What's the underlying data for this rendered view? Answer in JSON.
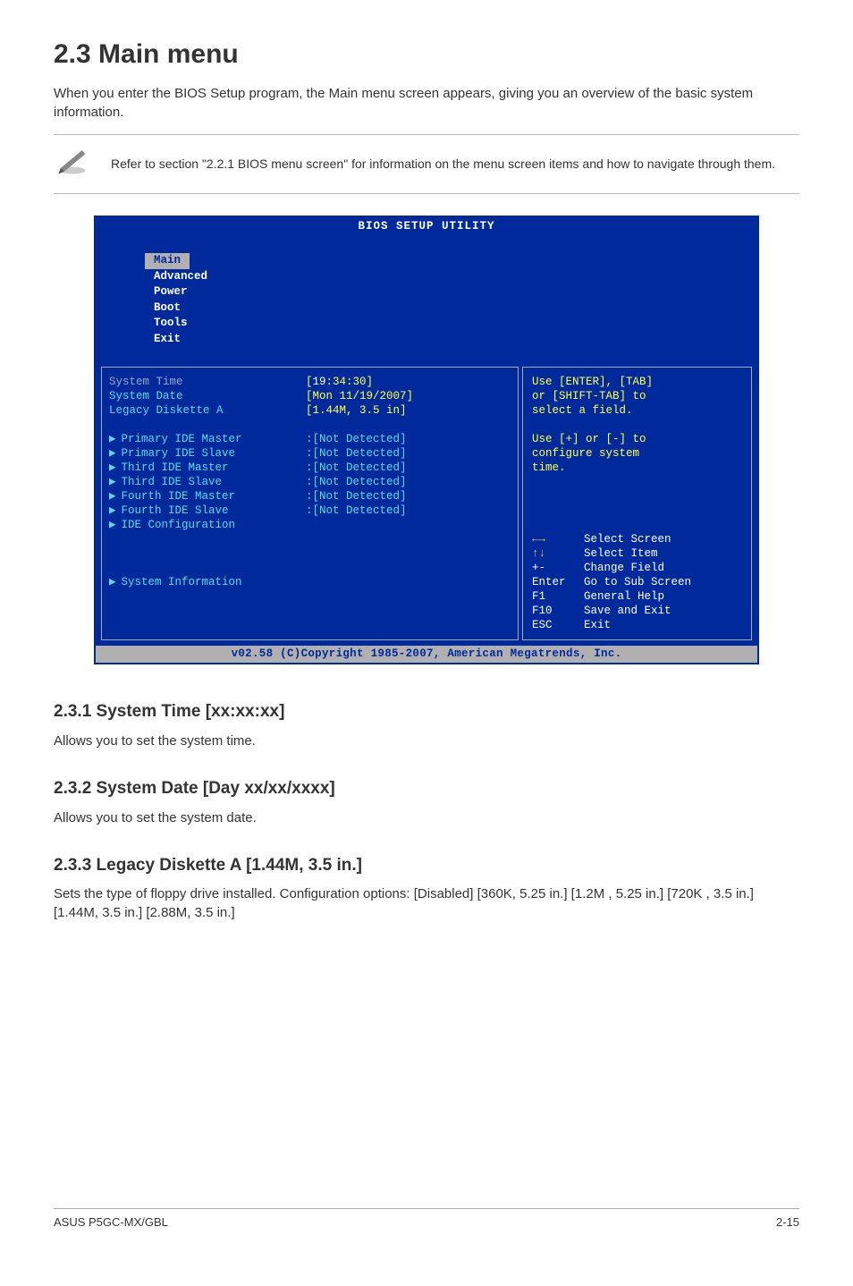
{
  "doc": {
    "section_title": "2.3    Main menu",
    "intro_p": "When you enter the BIOS Setup program, the Main menu screen appears, giving you an overview of the basic system information.",
    "note_text": "Refer to section \"2.2.1  BIOS menu screen\" for information on the menu screen items and how to navigate through them.",
    "sub1_h": "2.3.1     System Time [xx:xx:xx]",
    "sub1_p": "Allows you to set the system time.",
    "sub2_h": "2.3.2     System Date [Day xx/xx/xxxx]",
    "sub2_p": "Allows you to set the system date.",
    "sub3_h": "2.3.3     Legacy Diskette A [1.44M, 3.5 in.]",
    "sub3_p": "Sets the type of floppy drive installed. Configuration options: [Disabled] [360K, 5.25 in.] [1.2M , 5.25 in.] [720K , 3.5 in.] [1.44M, 3.5 in.] [2.88M, 3.5 in.]",
    "footer_left": "ASUS P5GC-MX/GBL",
    "footer_right": "2-15"
  },
  "bios": {
    "title": "BIOS SETUP UTILITY",
    "tabs": {
      "main": "Main",
      "advanced": "Advanced",
      "power": "Power",
      "boot": "Boot",
      "tools": "Tools",
      "exit": "Exit"
    },
    "left": {
      "sys_time_label": "System Time",
      "sys_time_value_prefix": "[",
      "sys_time_value_hh": "19",
      "sys_time_value_rest": ":34:30]",
      "sys_date_label": "System Date",
      "sys_date_value": "[Mon 11/19/2007]",
      "legacy_label": "Legacy Diskette A",
      "legacy_value": "[1.44M, 3.5 in]",
      "items": {
        "pim": "Primary IDE Master",
        "pis": "Primary IDE Slave",
        "tim": "Third IDE Master",
        "tis": "Third IDE Slave",
        "fim": "Fourth IDE Master",
        "fis": "Fourth IDE Slave",
        "idec": "IDE Configuration",
        "sysinfo": "System Information"
      },
      "not_detected": ":[Not Detected]"
    },
    "right": {
      "help1": "Use [ENTER], [TAB]",
      "help2": "or [SHIFT-TAB] to",
      "help3": "select a field.",
      "help4": "Use [+] or [-] to",
      "help5": "configure system",
      "help6": "time.",
      "k_lr": "←→",
      "t_lr": "Select Screen",
      "k_ud": "↑↓",
      "t_ud": "Select Item",
      "k_pm": "+-",
      "t_pm": "Change Field",
      "k_en": "Enter",
      "t_en": "Go to Sub Screen",
      "k_f1": "F1",
      "t_f1": "General Help",
      "k_f10": "F10",
      "t_f10": "Save and Exit",
      "k_esc": "ESC",
      "t_esc": "Exit"
    },
    "footer": "v02.58 (C)Copyright 1985-2007, American Megatrends, Inc."
  }
}
